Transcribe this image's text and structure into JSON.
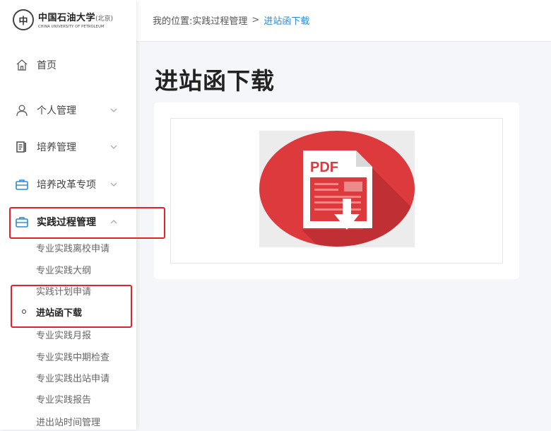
{
  "logo": {
    "emblem": "中",
    "name_cn": "中国石油大学",
    "name_suffix": "(北京)",
    "name_en": "CHINA UNIVERSITY OF PETROLEUM"
  },
  "sidebar": {
    "items": [
      {
        "label": "首页",
        "icon": "home-icon"
      },
      {
        "label": "个人管理",
        "icon": "person-icon"
      },
      {
        "label": "培养管理",
        "icon": "document-icon"
      },
      {
        "label": "培养改革专项",
        "icon": "briefcase-icon"
      },
      {
        "label": "实践过程管理",
        "icon": "briefcase-icon"
      }
    ],
    "subitems": [
      {
        "label": "专业实践离校申请"
      },
      {
        "label": "专业实践大纲"
      },
      {
        "label": "实践计划申请"
      },
      {
        "label": "进站函下载"
      },
      {
        "label": "专业实践月报"
      },
      {
        "label": "专业实践中期检查"
      },
      {
        "label": "专业实践出站申请"
      },
      {
        "label": "专业实践报告"
      },
      {
        "label": "进出站时间管理"
      }
    ]
  },
  "breadcrumb": {
    "prefix": "我的位置:",
    "parent": "实践过程管理",
    "separator": ">",
    "current": "进站函下载"
  },
  "page": {
    "title": "进站函下载"
  },
  "pdf": {
    "label": "PDF",
    "icon": "pdf-download-icon"
  },
  "colors": {
    "accent_blue": "#2a8ad6",
    "highlight_red": "#e0242a",
    "pdf_red": "#dd3a3e"
  }
}
